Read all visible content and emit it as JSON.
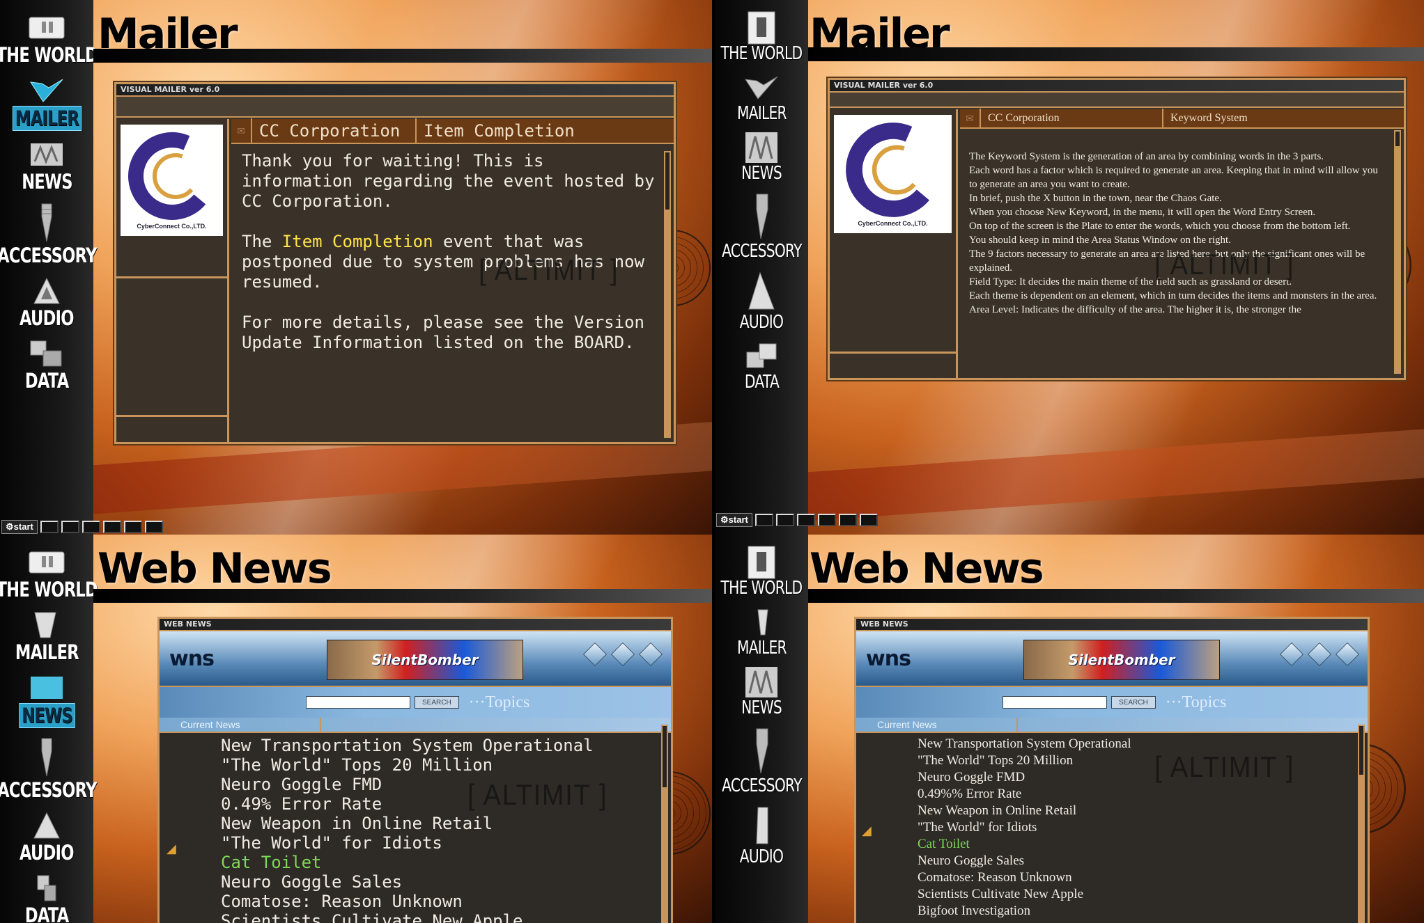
{
  "sidebar": [
    "THE WORLD",
    "MAILER",
    "NEWS",
    "ACCESSORY",
    "AUDIO",
    "DATA"
  ],
  "taskbar": {
    "start_label": "start"
  },
  "mailer": {
    "title": "Mailer",
    "window_label": "VISUAL MAILER ver 6.0",
    "logo_caption": "CyberConnect Co.,LTD.",
    "watermark": "[ ALTIMIT ]",
    "p1_tabs": [
      "CC Corporation",
      "Item Completion"
    ],
    "p1_body": {
      "para1": "Thank you for waiting! This is information regarding the event hosted by CC Corporation.",
      "para2_pre": "The ",
      "para2_highlight": "Item Completion",
      "para2_post": " event that was postponed due to system problems has now resumed.",
      "para3": "For more details, please see the Version Update Information listed on the BOARD."
    },
    "p2_tabs": [
      "CC Corporation",
      "Keyword System"
    ],
    "p2_body": [
      "The Keyword System is the generation of an area by combining words in the 3 parts.",
      "Each word has a factor which is required to generate an area. Keeping that in mind will allow you to generate an area you want to create.",
      "In brief, push the X button in the town, near the Chaos Gate.",
      "When you choose New Keyword, in the menu, it will open the Word Entry Screen.",
      "On top of the screen is the Plate to enter the words, which you choose from the bottom left.",
      "You should keep in mind the Area Status Window on the right.",
      "The 9 factors necessary to generate an area are listed here, but only the significant ones will be explained.",
      "Field Type: It decides the main theme of the field such as grassland or desert.",
      "Each theme is dependent on an element, which in turn decides the items and monsters in the area.",
      "Area Level: Indicates the difficulty of the area. The higher it is, the stronger the"
    ]
  },
  "webnews": {
    "title": "Web News",
    "window_label": "WEB NEWS",
    "brand": "wns",
    "banner": "SilentBomber",
    "search_button": "SEARCH",
    "topics": "Topics",
    "current_news": "Current News",
    "p3_items": [
      "New Transportation System Operational",
      "\"The World\" Tops 20 Million",
      "Neuro Goggle FMD",
      "0.49% Error Rate",
      "New Weapon in Online Retail",
      "\"The World\" for Idiots",
      "Cat Toilet",
      "Neuro Goggle Sales",
      "Comatose: Reason Unknown",
      "Scientists Cultivate New Apple"
    ],
    "p4_items": [
      "New Transportation System Operational",
      "\"The World\" Tops 20 Million",
      "Neuro Goggle FMD",
      "0.49%% Error Rate",
      "New Weapon in Online Retail",
      "\"The World\" for Idiots",
      "Cat Toilet",
      "Neuro Goggle Sales",
      "Comatose: Reason Unknown",
      "Scientists Cultivate New Apple",
      "Bigfoot Investigation"
    ],
    "selected_index": 6
  }
}
